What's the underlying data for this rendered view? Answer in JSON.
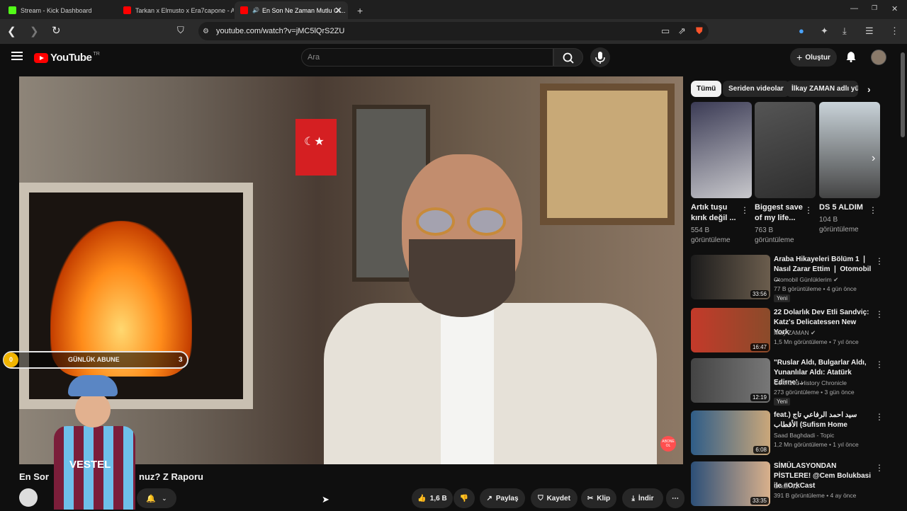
{
  "browser": {
    "tabs": [
      {
        "title": "Stream - Kick Dashboard"
      },
      {
        "title": "Tarkan x Elmusto x Era7capone - AD..."
      },
      {
        "title": "En Son Ne Zaman Mutlu Ol..."
      }
    ],
    "url": "youtube.com/watch?v=jMC5lQrS2ZU"
  },
  "header": {
    "logo_text": "YouTube",
    "country_code": "TR",
    "search_placeholder": "Ara",
    "create_label": "Oluştur"
  },
  "overlay": {
    "left_count": "0",
    "label": "GÜNLÜK ABUNE",
    "right_count": "3",
    "jersey_text": "VESTEL",
    "abone_badge": "ABONE OL"
  },
  "video": {
    "title_part1": "En Sor",
    "title_part2": "nuz? Z Raporu",
    "like_count": "1,6 B",
    "share_label": "Paylaş",
    "save_label": "Kaydet",
    "clip_label": "Klip",
    "download_label": "İndir"
  },
  "chips": [
    "Tümü",
    "Seriden videolar",
    "İlkay ZAMAN adlı yük"
  ],
  "shorts": [
    {
      "title": "Artık tuşu kırık değil ...",
      "views_line1": "554 B",
      "views_line2": "görüntüleme"
    },
    {
      "title": "Biggest save of my life...",
      "views_line1": "763 B",
      "views_line2": "görüntüleme"
    },
    {
      "title": "DS 5 ALDIM",
      "views_line1": "104 B",
      "views_line2": "görüntüleme"
    }
  ],
  "recommendations": [
    {
      "title": "Araba Hikayeleri Bölüm 1 ❘ Nasıl Zarar Ettim ❘ Otomobil ...",
      "channel": "Otomobil Günlüklerim ✔",
      "meta": "77 B görüntüleme • 4 gün önce",
      "badge": "Yeni",
      "duration": "33:56"
    },
    {
      "title": "22 Dolarlık Dev Etli Sandviç: Katz's Delicatessen New York",
      "channel": "İlkay ZAMAN ✔",
      "meta": "1,5 Mn görüntüleme • 7 yıl önce",
      "badge": "",
      "duration": "16:47"
    },
    {
      "title": "\"Ruslar Aldı, Bulgarlar Aldı, Yunanlılar Aldı: Atatürk Edirne'...",
      "channel": "Colorized History Chronicle",
      "meta": "273 görüntüleme • 3 gün önce",
      "badge": "Yeni",
      "duration": "12:19"
    },
    {
      "title": "feat.) سيد احمد الرفاعي تاج الأقطاب (Sufism Home",
      "channel": "Saad Baghdadi - Topic",
      "meta": "1,2 Mn görüntüleme • 1 yıl önce",
      "badge": "",
      "duration": "6:08"
    },
    {
      "title": "SİMÜLASYONDAN PİSTLERE! @Cem Bolukbasi ile #OrkCast",
      "channel": "Orkun v2",
      "meta": "391 B görüntüleme • 4 ay önce",
      "badge": "",
      "duration": "33:35"
    }
  ],
  "colors": {
    "brand_red": "#ff0000",
    "background": "#0f0f0f",
    "surface": "#272727"
  }
}
